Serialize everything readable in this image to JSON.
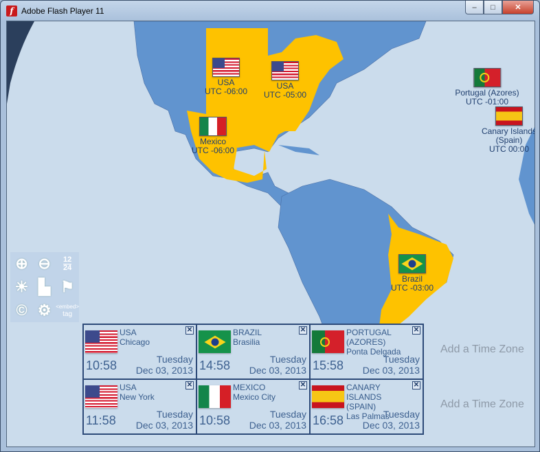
{
  "window": {
    "title": "Adobe Flash Player 11",
    "minimize": "–",
    "maximize": "□",
    "close": "✕"
  },
  "markers": [
    {
      "country": "USA",
      "utc": "UTC -06:00",
      "flag": "usa"
    },
    {
      "country": "USA",
      "utc": "UTC -05:00",
      "flag": "usa"
    },
    {
      "country": "Portugal (Azores)",
      "utc": "UTC -01:00",
      "flag": "por"
    },
    {
      "country": "Canary Islands",
      "country2": "(Spain)",
      "utc": "UTC 00:00",
      "flag": "esp"
    },
    {
      "country": "Mexico",
      "utc": "UTC -06:00",
      "flag": "mex"
    },
    {
      "country": "Brazil",
      "utc": "UTC -03:00",
      "flag": "bra"
    }
  ],
  "tools": {
    "zoom_in": "zoom-in",
    "zoom_out": "zoom-out",
    "format_12": "12",
    "format_24": "24",
    "daylight": "sun",
    "cities": "city",
    "flag": "flag",
    "copyright": "©",
    "settings": "gear",
    "embed": "embed",
    "embed_tag": "tag"
  },
  "zones": [
    {
      "country": "USA",
      "city": "Chicago",
      "time": "10:58",
      "day": "Tuesday",
      "date": "Dec 03, 2013",
      "flag": "usa"
    },
    {
      "country": "BRAZIL",
      "city": "Brasilia",
      "time": "14:58",
      "day": "Tuesday",
      "date": "Dec 03, 2013",
      "flag": "bra"
    },
    {
      "country": "PORTUGAL (AZORES)",
      "city": "Ponta Delgada",
      "time": "15:58",
      "day": "Tuesday",
      "date": "Dec 03, 2013",
      "flag": "por"
    },
    {
      "country": "USA",
      "city": "New York",
      "time": "11:58",
      "day": "Tuesday",
      "date": "Dec 03, 2013",
      "flag": "usa"
    },
    {
      "country": "MEXICO",
      "city": "Mexico City",
      "time": "10:58",
      "day": "Tuesday",
      "date": "Dec 03, 2013",
      "flag": "mex"
    },
    {
      "country": "CANARY ISLANDS (SPAIN)",
      "city": "Las Palmas",
      "time": "16:58",
      "day": "Tuesday",
      "date": "Dec 03, 2013",
      "flag": "esp"
    }
  ],
  "close_label": "✕",
  "add_labels": [
    "Add a Time Zone",
    "Add a Time Zone"
  ],
  "colors": {
    "ocean": "#cbdcec",
    "land": "#6194cf",
    "highlight": "#fec200"
  }
}
